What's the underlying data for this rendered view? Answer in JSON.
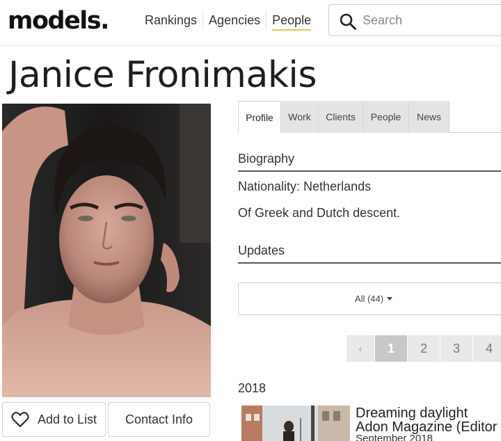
{
  "header": {
    "logo": "models.",
    "nav": [
      {
        "label": "Rankings"
      },
      {
        "label": "Agencies"
      },
      {
        "label": "People"
      }
    ],
    "search_placeholder": "Search"
  },
  "profile": {
    "name": "Janice Fronimakis",
    "add_to_list_label": "Add to List",
    "contact_info_label": "Contact Info"
  },
  "tabs": [
    {
      "label": "Profile",
      "active": true
    },
    {
      "label": "Work"
    },
    {
      "label": "Clients"
    },
    {
      "label": "People"
    },
    {
      "label": "News"
    }
  ],
  "biography": {
    "heading": "Biography",
    "nationality": "Nationality: Netherlands",
    "descent": "Of Greek and Dutch descent."
  },
  "updates": {
    "heading": "Updates",
    "filter_label": "All (44)",
    "pagination": {
      "prev": "‹",
      "pages": [
        "1",
        "2",
        "3",
        "4"
      ],
      "current": "1"
    },
    "year": "2018",
    "items": [
      {
        "title": "Dreaming daylight",
        "publication": "Adon Magazine (Editor",
        "date": "September 2018"
      }
    ]
  },
  "colors": {
    "nav_active_underline": "#e8c44a",
    "tab_inactive_bg": "#e4e4e4",
    "pagination_current_bg": "#c8c8c8"
  },
  "icons": [
    "search-icon",
    "heart-icon",
    "caret-down-icon"
  ]
}
